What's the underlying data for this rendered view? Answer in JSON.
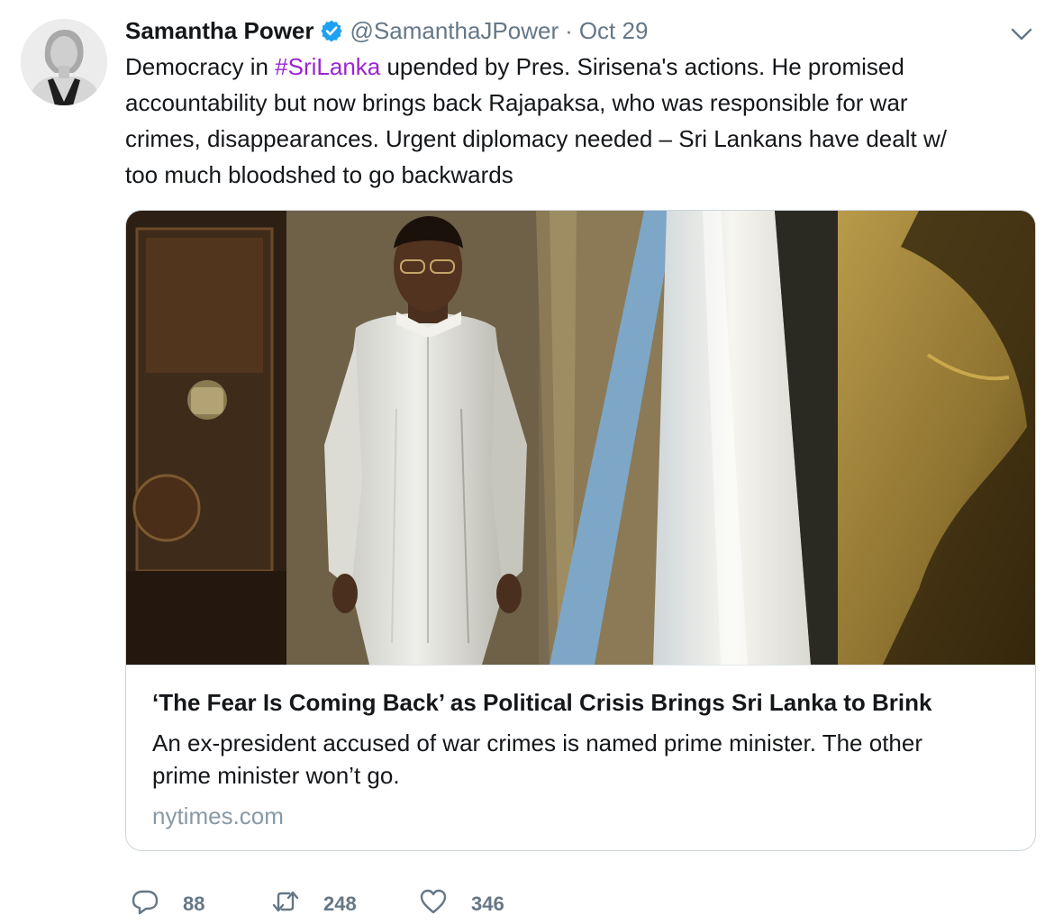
{
  "author": {
    "name": "Samantha Power",
    "handle": "@SamanthaJPower",
    "separator": "·",
    "date": "Oct 29"
  },
  "tweet": {
    "line1_pre": "Democracy in ",
    "hashtag": "#SriLanka",
    "line1_post": " upended by Pres. Sirisena's actions. He promised",
    "line2": "accountability but now brings back Rajapaksa, who was responsible for war",
    "line3": "crimes, disappearances. Urgent diplomacy needed – Sri Lankans have dealt w/",
    "line4": "too much bloodshed to go backwards"
  },
  "card": {
    "title": "‘The Fear Is Coming Back’ as Political Crisis Brings Sri Lanka to Brink",
    "description_line1": "An ex-president accused of war crimes is named prime minister. The other",
    "description_line2": "prime minister won’t go.",
    "domain": "nytimes.com"
  },
  "actions": {
    "replies": "88",
    "retweets": "248",
    "likes": "346"
  },
  "icons": {
    "verified": "verified-badge-icon",
    "caret": "chevron-down-icon",
    "reply": "reply-icon",
    "retweet": "retweet-icon",
    "like": "heart-icon"
  },
  "colors": {
    "hashtag": "#9b24d3",
    "verified": "#1da1f2",
    "secondary_text": "#657786",
    "card_border": "#ccd6dd"
  }
}
